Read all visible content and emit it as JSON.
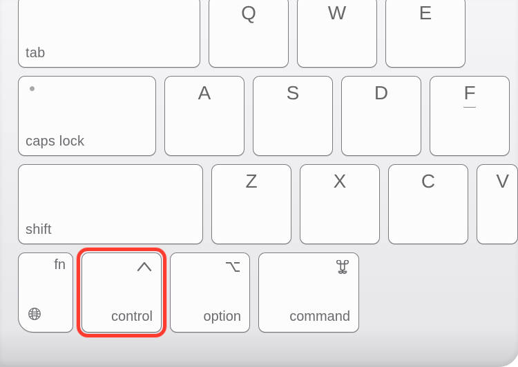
{
  "row1": {
    "tab": "tab",
    "q": "Q",
    "w": "W",
    "e": "E"
  },
  "row2": {
    "caps": "caps lock",
    "a": "A",
    "s": "S",
    "d": "D",
    "f": "F"
  },
  "row3": {
    "shift": "shift",
    "z": "Z",
    "x": "X",
    "c": "C",
    "v": "V"
  },
  "row4": {
    "fn": "fn",
    "control": "control",
    "option": "option",
    "command": "command"
  },
  "icons": {
    "globe": "globe-icon",
    "control_symbol": "control-symbol-icon",
    "option_symbol": "option-symbol-icon",
    "command_symbol": "command-symbol-icon"
  }
}
